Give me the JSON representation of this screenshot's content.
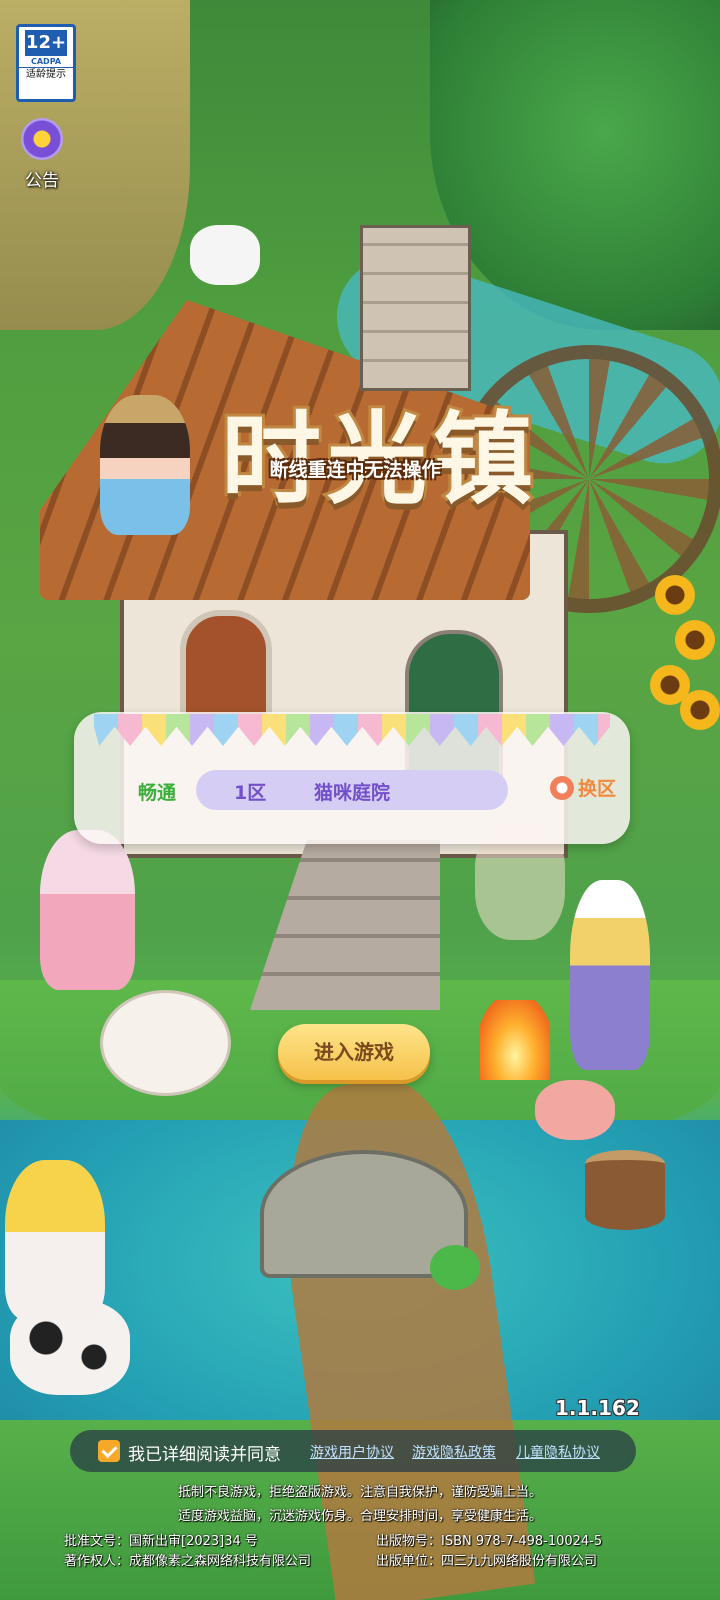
{
  "age_rating": {
    "label": "12+",
    "org": "CADPA",
    "tip": "适龄提示"
  },
  "notice": {
    "label": "公告",
    "icon": "megaphone-icon"
  },
  "logo": {
    "title": "时光镇"
  },
  "status_banner": "断线重连中无法操作",
  "server": {
    "status": "畅通",
    "zone": "1区",
    "name": "猫咪庭院",
    "switch_label": "换区",
    "switch_icon": "swap-icon"
  },
  "enter_button": "进入游戏",
  "version": "1.1.162",
  "agreement": {
    "checked": true,
    "text": "我已详细阅读并同意",
    "links": [
      "游戏用户协议",
      "游戏隐私政策",
      "儿童隐私协议"
    ]
  },
  "health_notice": [
    "抵制不良游戏，拒绝盗版游戏。注意自我保护，谨防受骗上当。",
    "适度游戏益脑，沉迷游戏伤身。合理安排时间，享受健康生活。"
  ],
  "legal": {
    "approval": "批准文号：国新出审[2023]34 号",
    "isbn": "出版物号：ISBN 978-7-498-10024-5",
    "copyright": "著作权人：成都像素之森网络科技有限公司",
    "publisher": "出版单位：四三九九网络股份有限公司"
  },
  "colors": {
    "accent": "#f6c24a",
    "server_status": "#3cae3c",
    "server_text": "#7250c8",
    "switch": "#f08a40"
  }
}
